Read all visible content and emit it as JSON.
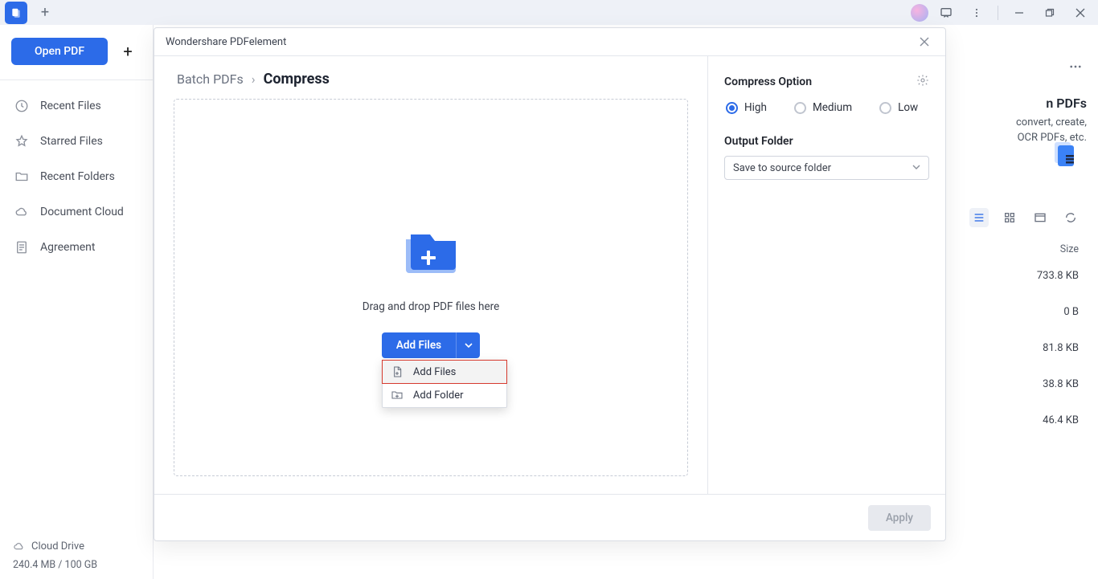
{
  "titlebar": {},
  "sidebar": {
    "open_label": "Open PDF",
    "items": [
      {
        "label": "Recent Files"
      },
      {
        "label": "Starred Files"
      },
      {
        "label": "Recent Folders"
      },
      {
        "label": "Document Cloud"
      },
      {
        "label": "Agreement"
      }
    ],
    "cloud_label": "Cloud Drive",
    "storage": "240.4 MB / 100 GB"
  },
  "behind": {
    "title_suffix": "n PDFs",
    "sub1": "convert, create,",
    "sub2": "OCR PDFs, etc.",
    "size_header": "Size",
    "sizes": [
      "733.8 KB",
      "0 B",
      "81.8 KB",
      "38.8 KB",
      "46.4 KB"
    ]
  },
  "modal": {
    "app_title": "Wondershare PDFelement",
    "breadcrumb_root": "Batch PDFs",
    "breadcrumb_current": "Compress",
    "dropzone_text": "Drag and drop PDF files here",
    "add_files_label": "Add Files",
    "menu": {
      "add_files": "Add Files",
      "add_folder": "Add Folder"
    },
    "right": {
      "title": "Compress Option",
      "radio_high": "High",
      "radio_medium": "Medium",
      "radio_low": "Low",
      "output_label": "Output Folder",
      "output_value": "Save to source folder"
    },
    "apply_label": "Apply"
  }
}
